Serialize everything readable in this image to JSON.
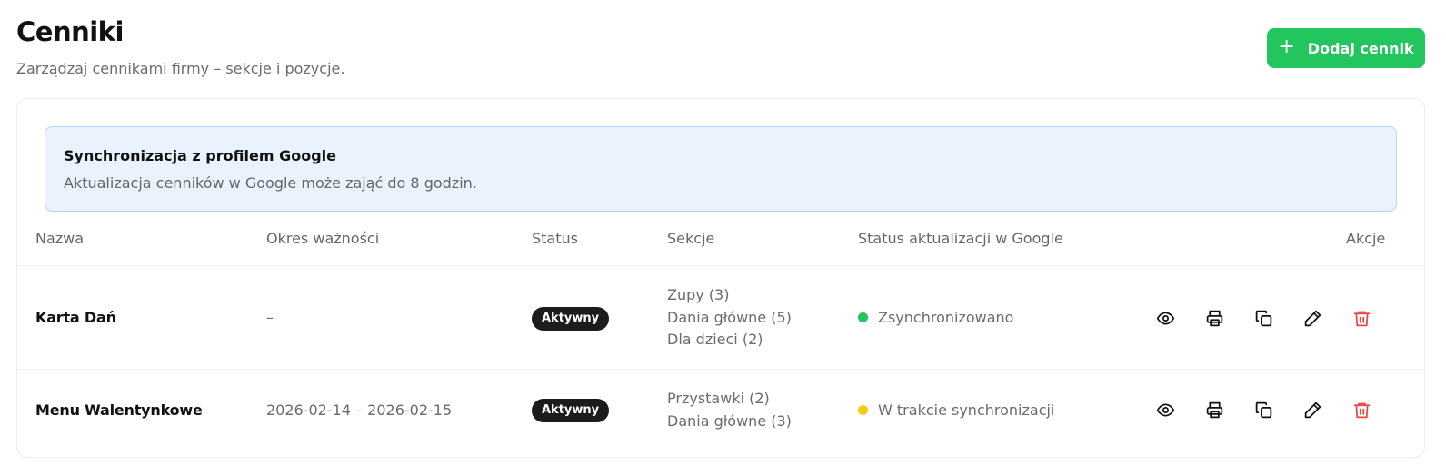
{
  "header": {
    "title": "Cenniki",
    "subtitle": "Zarządzaj cennikami firmy – sekcje i pozycje.",
    "add_button_label": "Dodaj cennik",
    "add_button_icon": "plus-icon",
    "add_button_color": "#22c55e"
  },
  "banner": {
    "title": "Synchronizacja z profilem Google",
    "text": "Aktualizacja cenników w Google może zająć do 8 godzin."
  },
  "table": {
    "columns": [
      "Nazwa",
      "Okres ważności",
      "Status",
      "Sekcje",
      "Status aktualizacji w Google",
      "Akcje"
    ],
    "rows": [
      {
        "name": "Karta Dań",
        "period": "–",
        "status": "Aktywny",
        "sections": [
          "Zupy (3)",
          "Dania główne (5)",
          "Dla dzieci (2)"
        ],
        "google_status": "Zsynchronizowano",
        "google_status_color": "#22c55e"
      },
      {
        "name": "Menu Walentynkowe",
        "period": "2026-02-14 – 2026-02-15",
        "status": "Aktywny",
        "sections": [
          "Przystawki (2)",
          "Dania główne (3)"
        ],
        "google_status": "W trakcie synchronizacji",
        "google_status_color": "#facc15"
      }
    ],
    "action_icons": [
      "eye-icon",
      "printer-icon",
      "copy-icon",
      "pencil-icon",
      "trash-icon"
    ],
    "delete_color": "#ef4444"
  }
}
